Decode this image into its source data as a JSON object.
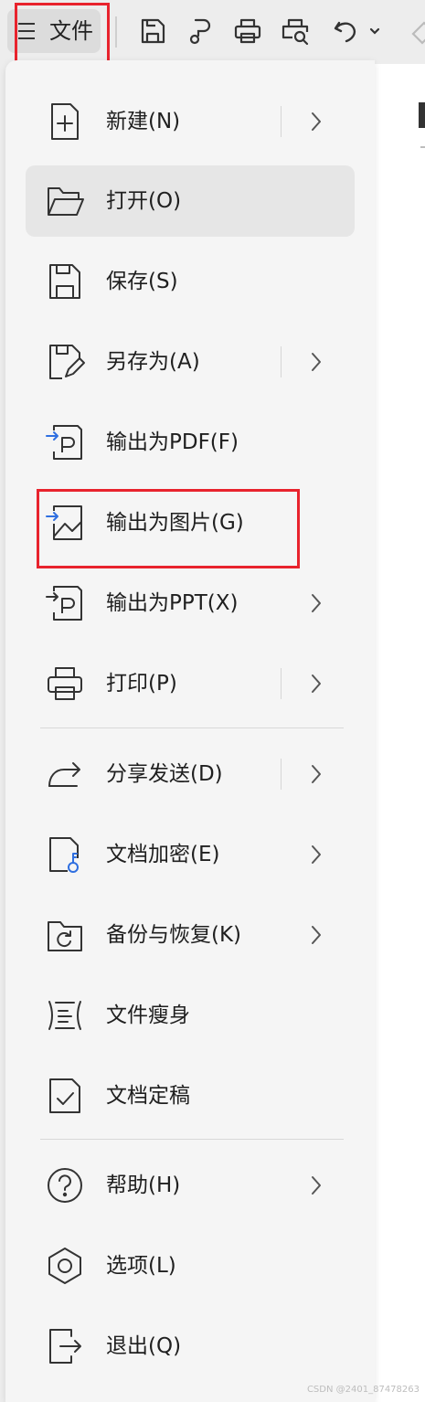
{
  "toolbar": {
    "file_label": "文件",
    "icons": [
      "save-icon",
      "format-brush-icon",
      "print-icon",
      "print-preview-icon",
      "undo-icon",
      "undo-dropdown-icon"
    ]
  },
  "menu": {
    "items": [
      {
        "label": "新建(N)",
        "icon": "new-file-icon",
        "submenu": true
      },
      {
        "label": "打开(O)",
        "icon": "open-folder-icon",
        "submenu": false,
        "hovered": true
      },
      {
        "label": "保存(S)",
        "icon": "save-icon",
        "submenu": false
      },
      {
        "label": "另存为(A)",
        "icon": "save-as-icon",
        "submenu": true
      },
      {
        "label": "输出为PDF(F)",
        "icon": "export-pdf-icon",
        "submenu": false
      },
      {
        "label": "输出为图片(G)",
        "icon": "export-image-icon",
        "submenu": false,
        "highlighted": true
      },
      {
        "label": "输出为PPT(X)",
        "icon": "export-ppt-icon",
        "submenu": true
      },
      {
        "label": "打印(P)",
        "icon": "print-icon",
        "submenu": true
      },
      {
        "label": "分享发送(D)",
        "icon": "share-icon",
        "submenu": true
      },
      {
        "label": "文档加密(E)",
        "icon": "encrypt-icon",
        "submenu": true
      },
      {
        "label": "备份与恢复(K)",
        "icon": "backup-restore-icon",
        "submenu": true
      },
      {
        "label": "文件瘦身",
        "icon": "slim-file-icon",
        "submenu": false
      },
      {
        "label": "文档定稿",
        "icon": "finalize-icon",
        "submenu": false
      },
      {
        "label": "帮助(H)",
        "icon": "help-icon",
        "submenu": true
      },
      {
        "label": "选项(L)",
        "icon": "options-icon",
        "submenu": false
      },
      {
        "label": "退出(Q)",
        "icon": "exit-icon",
        "submenu": false
      }
    ]
  },
  "colors": {
    "highlight_box": "#e8232d",
    "accent_blue": "#2f6fe0",
    "menu_bg": "#f5f5f5",
    "hover_bg": "#e6e6e6"
  },
  "watermark": "CSDN @2401_87478263"
}
